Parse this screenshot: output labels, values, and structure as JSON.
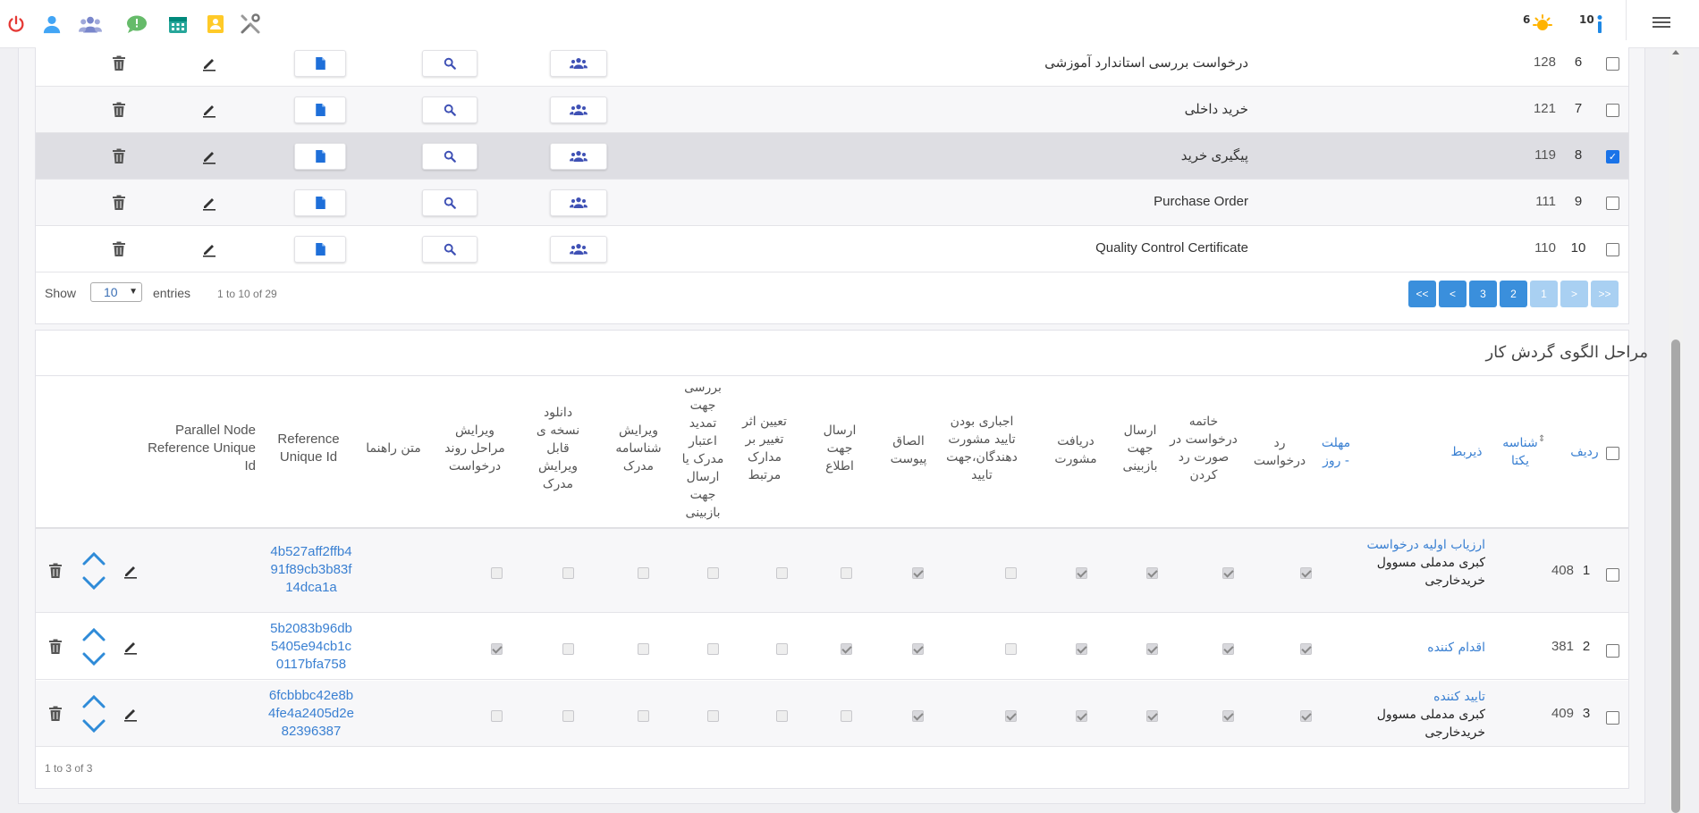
{
  "topbar": {
    "alerts_count": "6",
    "info_count": "10",
    "icons": [
      "power-icon",
      "user-icon",
      "users-icon",
      "chat-icon",
      "calendar-icon",
      "contact-card-icon",
      "tools-icon"
    ]
  },
  "doc_table": {
    "rows": [
      {
        "num": "6",
        "id": "128",
        "title": "درخواست بررسی استاندارد آموزشی",
        "checked": false
      },
      {
        "num": "7",
        "id": "121",
        "title": "خرید داخلی",
        "checked": false
      },
      {
        "num": "8",
        "id": "119",
        "title": "پیگیری خرید",
        "checked": true
      },
      {
        "num": "9",
        "id": "111",
        "title": "Purchase Order",
        "checked": false
      },
      {
        "num": "10",
        "id": "110",
        "title": "Quality Control Certificate",
        "checked": false
      }
    ],
    "footer": {
      "show_label": "Show",
      "page_size": "10",
      "entries_label": "entries",
      "info": "1 to 10 of 29"
    },
    "pagination": [
      "<<",
      "<",
      "3",
      "2",
      "1",
      ">",
      ">>"
    ]
  },
  "workflow": {
    "title": "مراحل الگوی گردش کار",
    "headers": {
      "row": "ردیف",
      "unique_id": "شناسه یکتا",
      "beneficiary": "ذیربط",
      "deadline": "مهلت - روز",
      "reject": "رد درخواست",
      "terminate": "خاتمه درخواست در صورت رد کردن",
      "send_review": "ارسال جهت بازبینی",
      "get_consult": "دریافت مشورت",
      "mandatory_consult": "اجباری بودن تایید مشورت دهندگان،جهت تایید",
      "attach": "الصاق پیوست",
      "send_info": "ارسال جهت اطلاع",
      "change_effect": "تعیین اثر تغییر بر مدارک مرتبط",
      "review_validity": "بررسی جهت تمدید اعتبار مدرک یا ارسال جهت بازبینی",
      "edit_doc_id": "ویرایش شناسامه مدرک",
      "download_copy": "دانلود نسخه ی قابل ویرایش مدرک",
      "edit_flow": "ویرایش مراحل روند درخواست",
      "guide": "متن راهنما",
      "ref_uid": "Reference Unique Id",
      "parallel_ref": "Parallel Node Reference Unique Id"
    },
    "rows": [
      {
        "num": "1",
        "id": "408",
        "name_a": "ارزیاب اولیه درخواست",
        "name_b": "کبری مدملی مسوول خریدخارجی",
        "ref": [
          "4b527aff2ffb4",
          "91f89cb3b83f",
          "14dca1a"
        ]
      },
      {
        "num": "2",
        "id": "381",
        "name_a": "اقدام کننده",
        "name_b": "",
        "ref": [
          "5b2083b96db",
          "5405e94cb1c",
          "0117bfa758"
        ]
      },
      {
        "num": "3",
        "id": "409",
        "name_a": "تایید کننده",
        "name_b": "کبری مدملی مسوول خریدخارجی",
        "ref": [
          "6fcbbbc42e8b",
          "4fe4a2405d2e",
          "82396387"
        ]
      }
    ],
    "footer_info": "1 to 3 of 3"
  }
}
